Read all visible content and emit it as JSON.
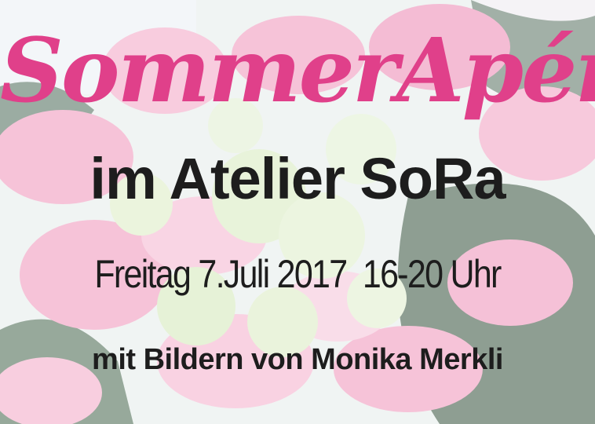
{
  "colors": {
    "title": "#e0408a",
    "text": "#1d1d1d",
    "petal": "#f3a9c8",
    "petal_light": "#f7cfe0",
    "floret": "#dfeecb",
    "leaf": "#4f6a55",
    "sky": "#eef3f6"
  },
  "background": {
    "description_icon": "hydrangea-photo"
  },
  "poster": {
    "title": "SommerApéro",
    "venue": "im Atelier SoRa",
    "date_line": "Freitag 7.Juli 2017  16-20 Uhr",
    "artist_line": "mit Bildern von Monika Merkli"
  }
}
